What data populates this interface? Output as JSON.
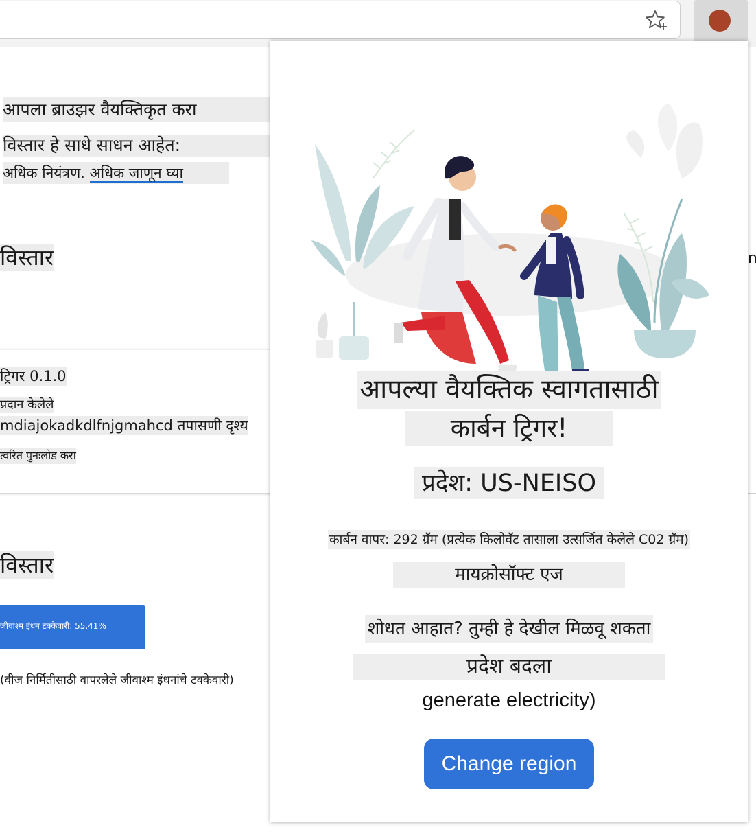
{
  "background_page": {
    "personalize_title": "आपला ब्राउझर वैयक्तिकृत करा",
    "personalize_desc": "विस्तार हे साधे साधन आहेत:",
    "control_text": "अधिक नियंत्रण. ",
    "learn_more_link": "अधिक जाणून घ्या",
    "section_heading_1": "विस्तार",
    "extension_card": {
      "name_version": "ट्रिगर 0.1.0",
      "provider": "प्रदान केलेले",
      "id_inspect": "mdiajokadkdlfnjgmahcd तपासणी दृश्य",
      "reload": "त्वरित पुनःलोड करा"
    },
    "section_heading_2": "विस्तार",
    "fossil_pill": "जीवाश्म इंधन टक्केवारी: 55.41%",
    "fossil_note": "(वीज निर्मितीसाठी वापरलेले जीवाश्म इंधनांचे टक्केवारी)",
    "right_edge_char": "n"
  },
  "browser_bar": {
    "favorite_icon": "star-add-icon",
    "extension_icon_color": "#a8432a"
  },
  "popup": {
    "headline_line1": "आपल्या वैयक्तिक स्वागतासाठी",
    "headline_line2": "कार्बन ट्रिगर!",
    "region": "प्रदेश: US-NEISO",
    "carbon_usage": "कार्बन वापर: 292 ग्रॅम (प्रत्येक किलोवॅट तासाला उत्सर्जित केलेले C02 ग्रॅम)",
    "browser_name": "मायक्रोसॉफ्ट एज",
    "search_prompt": "शोधत आहात? तुम्ही हे देखील मिळवू शकता",
    "change_region_heading": "प्रदेश बदला",
    "generate_text": "generate electricity)",
    "change_region_button": "Change region"
  },
  "colors": {
    "accent_blue": "#2f72d8",
    "text_highlight": "#eeeeee"
  }
}
